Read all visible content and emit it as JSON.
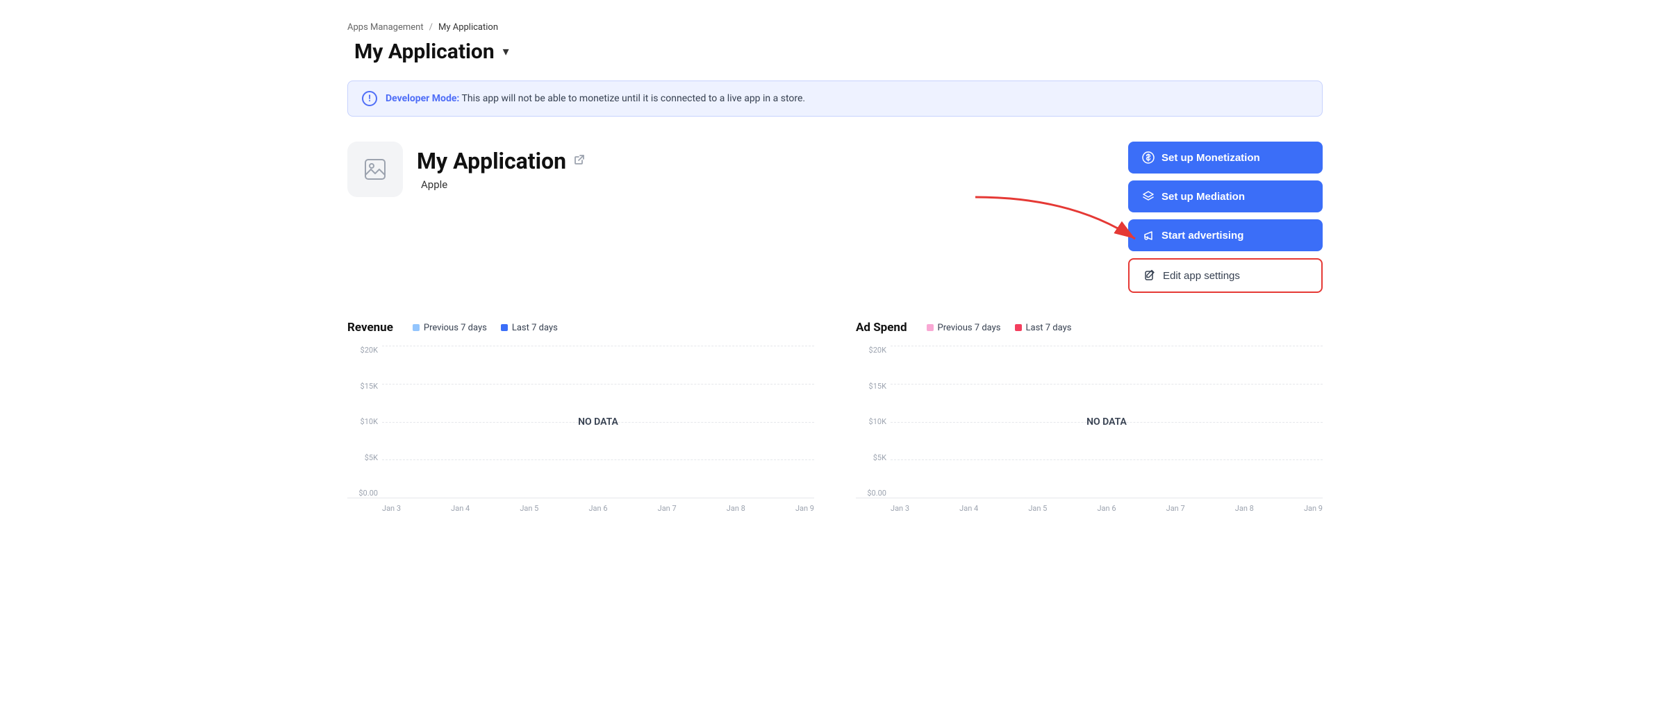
{
  "breadcrumb": {
    "parent": "Apps Management",
    "separator": "/",
    "current": "My Application"
  },
  "page_title": {
    "icon": "",
    "label": "My Application",
    "chevron": "▾"
  },
  "banner": {
    "bold_text": "Developer Mode:",
    "message": " This app will not be able to monetize until it is connected to a live app in a store."
  },
  "app": {
    "name": "My Application",
    "platform": "Apple",
    "platform_icon": ""
  },
  "buttons": {
    "monetization": "Set up Monetization",
    "mediation": "Set up Mediation",
    "advertising": "Start advertising",
    "edit_settings": "Edit app settings"
  },
  "revenue_chart": {
    "title": "Revenue",
    "legend": [
      {
        "label": "Previous 7 days",
        "color": "#93c5fd"
      },
      {
        "label": "Last 7 days",
        "color": "#3b6ef8"
      }
    ],
    "y_labels": [
      "$20K",
      "$15K",
      "$10K",
      "$5K",
      "$0.00"
    ],
    "x_labels": [
      "Jan 3",
      "Jan 4",
      "Jan 5",
      "Jan 6",
      "Jan 7",
      "Jan 8",
      "Jan 9"
    ],
    "no_data": "NO DATA"
  },
  "ad_spend_chart": {
    "title": "Ad Spend",
    "legend": [
      {
        "label": "Previous 7 days",
        "color": "#f9a8d4"
      },
      {
        "label": "Last 7 days",
        "color": "#f43f5e"
      }
    ],
    "y_labels": [
      "$20K",
      "$15K",
      "$10K",
      "$5K",
      "$0.00"
    ],
    "x_labels": [
      "Jan 3",
      "Jan 4",
      "Jan 5",
      "Jan 6",
      "Jan 7",
      "Jan 8",
      "Jan 9"
    ],
    "no_data": "NO DATA"
  }
}
